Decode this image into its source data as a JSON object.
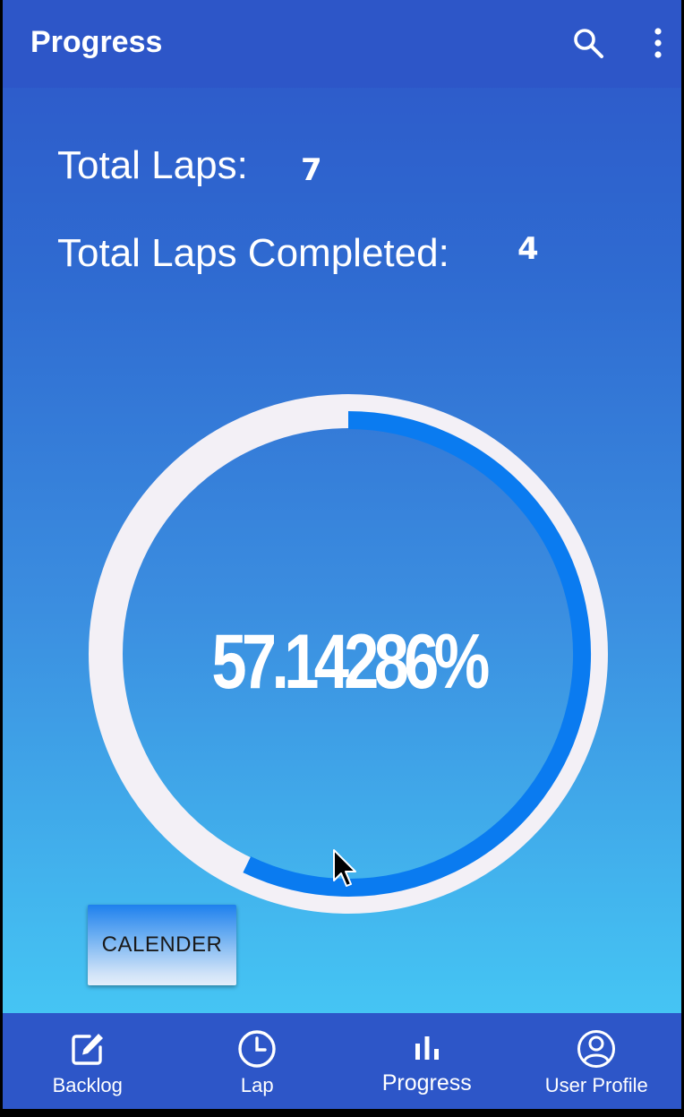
{
  "app_bar": {
    "title": "Progress",
    "search_icon": "search-icon",
    "more_icon": "more-vert-icon"
  },
  "stats": {
    "total_laps_label": "Total Laps:",
    "total_laps_value": "7",
    "completed_label": "Total Laps Completed:",
    "completed_value": "4"
  },
  "progress_ring": {
    "percent_text": "57.14286%",
    "fraction": 0.5714286,
    "track_color": "#f3f0f6",
    "progress_color": "#0a7bf0"
  },
  "calendar_button": {
    "label": "CALENDER"
  },
  "bottom_nav": {
    "items": [
      {
        "label": "Backlog",
        "icon": "edit-icon"
      },
      {
        "label": "Lap",
        "icon": "clock-icon"
      },
      {
        "label": "Progress",
        "icon": "bar-chart-icon"
      },
      {
        "label": "User Profile",
        "icon": "user-circle-icon"
      }
    ],
    "active": "Progress"
  },
  "colors": {
    "primary": "#2d56c8",
    "gradient_bottom": "#47c8f5"
  }
}
